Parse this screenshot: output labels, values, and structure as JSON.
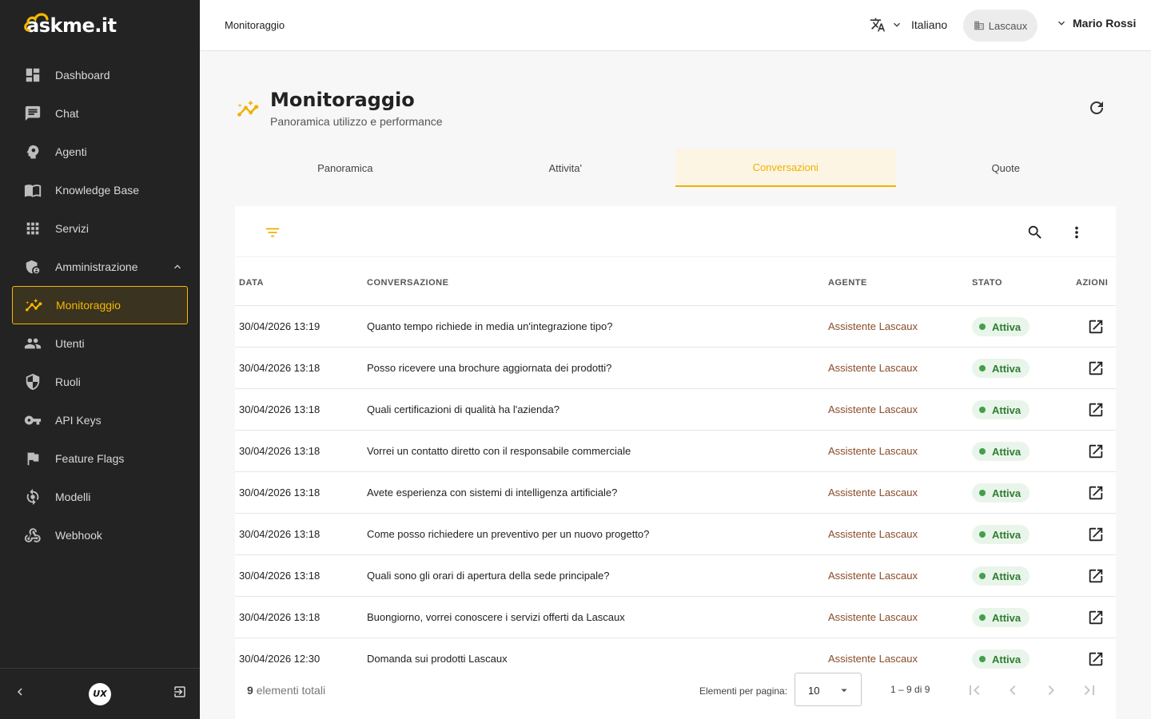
{
  "app": {
    "logo": "askme.it"
  },
  "sidebar": {
    "items": [
      {
        "label": "Dashboard",
        "icon": "dashboard-icon"
      },
      {
        "label": "Chat",
        "icon": "chat-icon"
      },
      {
        "label": "Agenti",
        "icon": "agent-icon"
      },
      {
        "label": "Knowledge Base",
        "icon": "book-icon"
      },
      {
        "label": "Servizi",
        "icon": "apps-icon"
      },
      {
        "label": "Amministrazione",
        "icon": "admin-icon"
      },
      {
        "label": "Monitoraggio",
        "icon": "monitoring-icon"
      },
      {
        "label": "Utenti",
        "icon": "users-icon"
      },
      {
        "label": "Ruoli",
        "icon": "shield-icon"
      },
      {
        "label": "API Keys",
        "icon": "key-icon"
      },
      {
        "label": "Feature Flags",
        "icon": "flag-icon"
      },
      {
        "label": "Modelli",
        "icon": "model-icon"
      },
      {
        "label": "Webhook",
        "icon": "webhook-icon"
      }
    ],
    "active": "Monitoraggio",
    "footer_badge": "UX"
  },
  "header": {
    "breadcrumb": "Monitoraggio",
    "language": "Italiano",
    "tenant": "Lascaux",
    "user": "Mario Rossi"
  },
  "page": {
    "title": "Monitoraggio",
    "subtitle": "Panoramica utilizzo e performance"
  },
  "tabs": [
    {
      "label": "Panoramica"
    },
    {
      "label": "Attivita'"
    },
    {
      "label": "Conversazioni"
    },
    {
      "label": "Quote"
    }
  ],
  "active_tab": "Conversazioni",
  "table": {
    "columns": [
      "DATA",
      "CONVERSAZIONE",
      "AGENTE",
      "STATO",
      "AZIONI"
    ],
    "rows": [
      {
        "date": "30/04/2026 13:19",
        "conversation": "Quanto tempo richiede in media un'integrazione tipo?",
        "agent": "Assistente Lascaux",
        "state": "Attiva"
      },
      {
        "date": "30/04/2026 13:18",
        "conversation": "Posso ricevere una brochure aggiornata dei prodotti?",
        "agent": "Assistente Lascaux",
        "state": "Attiva"
      },
      {
        "date": "30/04/2026 13:18",
        "conversation": "Quali certificazioni di qualità ha l'azienda?",
        "agent": "Assistente Lascaux",
        "state": "Attiva"
      },
      {
        "date": "30/04/2026 13:18",
        "conversation": "Vorrei un contatto diretto con il responsabile commerciale",
        "agent": "Assistente Lascaux",
        "state": "Attiva"
      },
      {
        "date": "30/04/2026 13:18",
        "conversation": "Avete esperienza con sistemi di intelligenza artificiale?",
        "agent": "Assistente Lascaux",
        "state": "Attiva"
      },
      {
        "date": "30/04/2026 13:18",
        "conversation": "Come posso richiedere un preventivo per un nuovo progetto?",
        "agent": "Assistente Lascaux",
        "state": "Attiva"
      },
      {
        "date": "30/04/2026 13:18",
        "conversation": "Quali sono gli orari di apertura della sede principale?",
        "agent": "Assistente Lascaux",
        "state": "Attiva"
      },
      {
        "date": "30/04/2026 13:18",
        "conversation": "Buongiorno, vorrei conoscere i servizi offerti da Lascaux",
        "agent": "Assistente Lascaux",
        "state": "Attiva"
      },
      {
        "date": "30/04/2026 12:30",
        "conversation": "Domanda sui prodotti Lascaux",
        "agent": "Assistente Lascaux",
        "state": "Attiva"
      }
    ]
  },
  "pagination": {
    "total_count": "9",
    "total_label": "elementi totali",
    "per_page_label": "Elementi per pagina:",
    "per_page_value": "10",
    "range": "1 – 9 di 9"
  },
  "colors": {
    "accent": "#f0b100",
    "sidebar_bg": "#232323",
    "status_active": "#2e7d32"
  }
}
